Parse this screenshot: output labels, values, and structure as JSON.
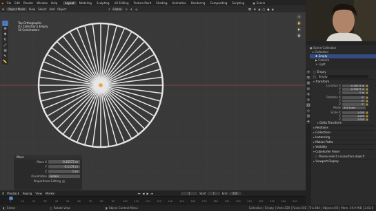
{
  "topbar": {
    "menus": [
      "File",
      "Edit",
      "Render",
      "Window",
      "Help"
    ],
    "workspaces": [
      "Layout",
      "Modeling",
      "Sculpting",
      "UV Editing",
      "Texture Paint",
      "Shading",
      "Animation",
      "Rendering",
      "Compositing",
      "Scripting"
    ],
    "active_workspace": "Layout",
    "scene": "Scene"
  },
  "header": {
    "mode": "Object Mode",
    "menus": [
      "View",
      "Select",
      "Add",
      "Object"
    ],
    "transform": "Global"
  },
  "viewport": {
    "info_lines": [
      "Top Orthographic",
      "(1) Collection | Empty",
      "10 Centimeters"
    ],
    "spokes": 48
  },
  "redo_panel": {
    "title": "Move",
    "rows": [
      {
        "label": "Move X",
        "value": "-0.26573 m"
      },
      {
        "label": "Y",
        "value": "-0.1174 m"
      },
      {
        "label": "Z",
        "value": "0 m"
      }
    ],
    "orientation_label": "Orientation",
    "orientation": "Global",
    "proportional": "Proportional Editing"
  },
  "timeline": {
    "menus": [
      "Playback",
      "Keying",
      "View",
      "Marker"
    ],
    "current_frame": "1",
    "start_label": "Start",
    "start": "1",
    "end_label": "End",
    "end": "250",
    "ticks": [
      "0",
      "10",
      "20",
      "30",
      "40",
      "50",
      "60",
      "70",
      "80",
      "90",
      "100",
      "110",
      "120",
      "130",
      "140",
      "150",
      "160",
      "170",
      "180",
      "190",
      "200",
      "210",
      "220",
      "230",
      "240",
      "250"
    ]
  },
  "statusbar": {
    "select": "Select",
    "rotate": "Rotate View",
    "context": "Object Context Menu",
    "stats": "Collection | Empty | Verts:320 | Faces:192 | Tris:384 | Objects:0/3 | Mem: 39.9 MiB | 2.83.0"
  },
  "outliner": {
    "items": [
      "Scene Collection",
      "Collection",
      "Empty",
      "Camera",
      "Light"
    ]
  },
  "properties": {
    "object_name": "Empty",
    "data_name": "Empty",
    "sections": {
      "transform": "Transform",
      "delta": "Delta Transform",
      "relations": "Relations",
      "collections": "Collections",
      "instancing": "Instancing",
      "motion": "Motion Paths",
      "visibility": "Visibility",
      "cubesurfer": "CubeSurfer Panel",
      "viewport_display": "Viewport Display"
    },
    "location_label": "Location X",
    "location": [
      "-0.26573 m",
      "-0.35877 m",
      "0 m"
    ],
    "rotation_label": "Rotation X",
    "rotation": [
      "0°",
      "0°",
      "0°"
    ],
    "mode_label": "Mode",
    "mode": "XYZ Euler",
    "scale_label": "Scale X",
    "scale": [
      "1.000",
      "1.000",
      "1.000"
    ],
    "y_label": "Y",
    "z_label": "Z",
    "notice": "Please select a isosurface object!"
  },
  "colors": {
    "accent": "#4772b3",
    "wire": "#e6e6e6",
    "axis_red": "#c24b3b"
  }
}
